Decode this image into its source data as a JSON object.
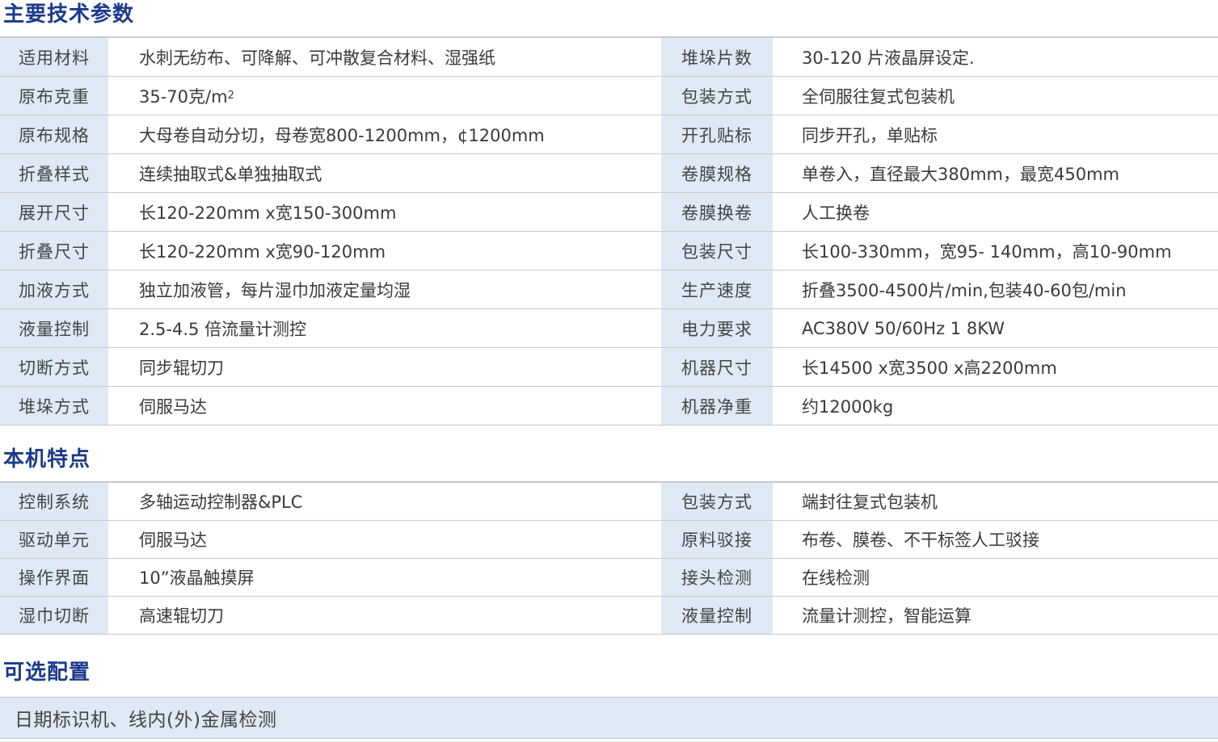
{
  "sections": {
    "specs_title": "主要技术参数",
    "features_title": "本机特点",
    "optional_title": "可选配置"
  },
  "specs": [
    {
      "l_label": "适用材料",
      "l_value": "水刺无纺布、可降解、可冲散复合材料、湿强纸",
      "r_label": "堆垛片数",
      "r_value": "30-120 片液晶屏设定."
    },
    {
      "l_label": "原布克重",
      "l_value": "35-70克/m",
      "r_label": "包装方式",
      "r_value": "全伺服往复式包装机"
    },
    {
      "l_label": "原布规格",
      "l_value": "大母卷自动分切，母卷宽800-1200mm，¢1200mm",
      "r_label": "开孔贴标",
      "r_value": "同步开孔，单贴标"
    },
    {
      "l_label": "折叠样式",
      "l_value": "连续抽取式&单独抽取式",
      "r_label": "卷膜规格",
      "r_value": "单卷入，直径最大380mm，最宽450mm"
    },
    {
      "l_label": "展开尺寸",
      "l_value": "长120-220mm x宽150-300mm",
      "r_label": "卷膜换卷",
      "r_value": "人工换卷"
    },
    {
      "l_label": "折叠尺寸",
      "l_value": "长120-220mm x宽90-120mm",
      "r_label": "包装尺寸",
      "r_value": "长100-330mm，宽95- 140mm，高10-90mm"
    },
    {
      "l_label": "加液方式",
      "l_value": "独立加液管，每片湿巾加液定量均湿",
      "r_label": "生产速度",
      "r_value": "折叠3500-4500片/min,包装40-60包/min"
    },
    {
      "l_label": "液量控制",
      "l_value": "2.5-4.5 倍流量计测控",
      "r_label": "电力要求",
      "r_value": "AC380V 50/60Hz 1 8KW"
    },
    {
      "l_label": "切断方式",
      "l_value": "同步辊切刀",
      "r_label": "机器尺寸",
      "r_value": "长14500 x宽3500 x高2200mm"
    },
    {
      "l_label": "堆垛方式",
      "l_value": "伺服马达",
      "r_label": "机器净重",
      "r_value": "约12000kg"
    }
  ],
  "spec_superscript": "2",
  "features": [
    {
      "l_label": "控制系统",
      "l_value": "多轴运动控制器&PLC",
      "r_label": "包装方式",
      "r_value": "端封往复式包装机"
    },
    {
      "l_label": "驱动单元",
      "l_value": "伺服马达",
      "r_label": "原料驳接",
      "r_value": "布卷、膜卷、不干标签人工驳接"
    },
    {
      "l_label": "操作界面",
      "l_value": "10”液晶触摸屏",
      "r_label": "接头检测",
      "r_value": "在线检测"
    },
    {
      "l_label": "湿巾切断",
      "l_value": "高速辊切刀",
      "r_label": "液量控制",
      "r_value": "流量计测控，智能运算"
    }
  ],
  "optional": "日期标识机、线内(外)金属检测"
}
